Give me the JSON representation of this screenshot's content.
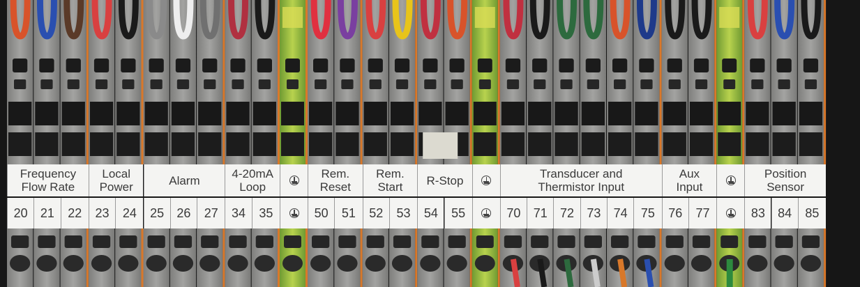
{
  "groups": [
    {
      "id": "frequency-flow-rate",
      "lines": [
        "Frequency",
        "Flow Rate"
      ],
      "terminals": [
        "20",
        "21",
        "22"
      ]
    },
    {
      "id": "local-power",
      "lines": [
        "Local",
        "Power"
      ],
      "terminals": [
        "23",
        "24"
      ]
    },
    {
      "id": "alarm",
      "lines": [
        "Alarm"
      ],
      "terminals": [
        "25",
        "26",
        "27"
      ]
    },
    {
      "id": "loop-4-20ma",
      "lines": [
        "4-20mA",
        "Loop"
      ],
      "terminals": [
        "34",
        "35"
      ]
    },
    {
      "id": "ground-1",
      "lines": [],
      "ground": true,
      "terminals": []
    },
    {
      "id": "rem-reset",
      "lines": [
        "Rem.",
        "Reset"
      ],
      "terminals": [
        "50",
        "51"
      ]
    },
    {
      "id": "rem-start",
      "lines": [
        "Rem.",
        "Start"
      ],
      "terminals": [
        "52",
        "53"
      ]
    },
    {
      "id": "r-stop",
      "lines": [
        "R-Stop"
      ],
      "terminals": [
        "54",
        "55"
      ]
    },
    {
      "id": "ground-2",
      "lines": [],
      "ground": true,
      "terminals": []
    },
    {
      "id": "transducer-thermistor",
      "lines": [
        "Transducer and",
        "Thermistor Input"
      ],
      "terminals": [
        "70",
        "71",
        "72",
        "73",
        "74",
        "75"
      ]
    },
    {
      "id": "aux-input",
      "lines": [
        "Aux",
        "Input"
      ],
      "terminals": [
        "76",
        "77"
      ]
    },
    {
      "id": "ground-3",
      "lines": [],
      "ground": true,
      "terminals": []
    },
    {
      "id": "position-sensor",
      "lines": [
        "Position",
        "Sensor"
      ],
      "terminals": [
        "83",
        "84",
        "85"
      ]
    }
  ],
  "colors": {
    "block_grey": "#8f8f8d",
    "block_grey_dark": "#6e6e6c",
    "ground_green": "#a7c942",
    "ground_yellow": "#d9dc55",
    "separator_orange": "#d9782a",
    "label_white": "#f4f4f2"
  }
}
